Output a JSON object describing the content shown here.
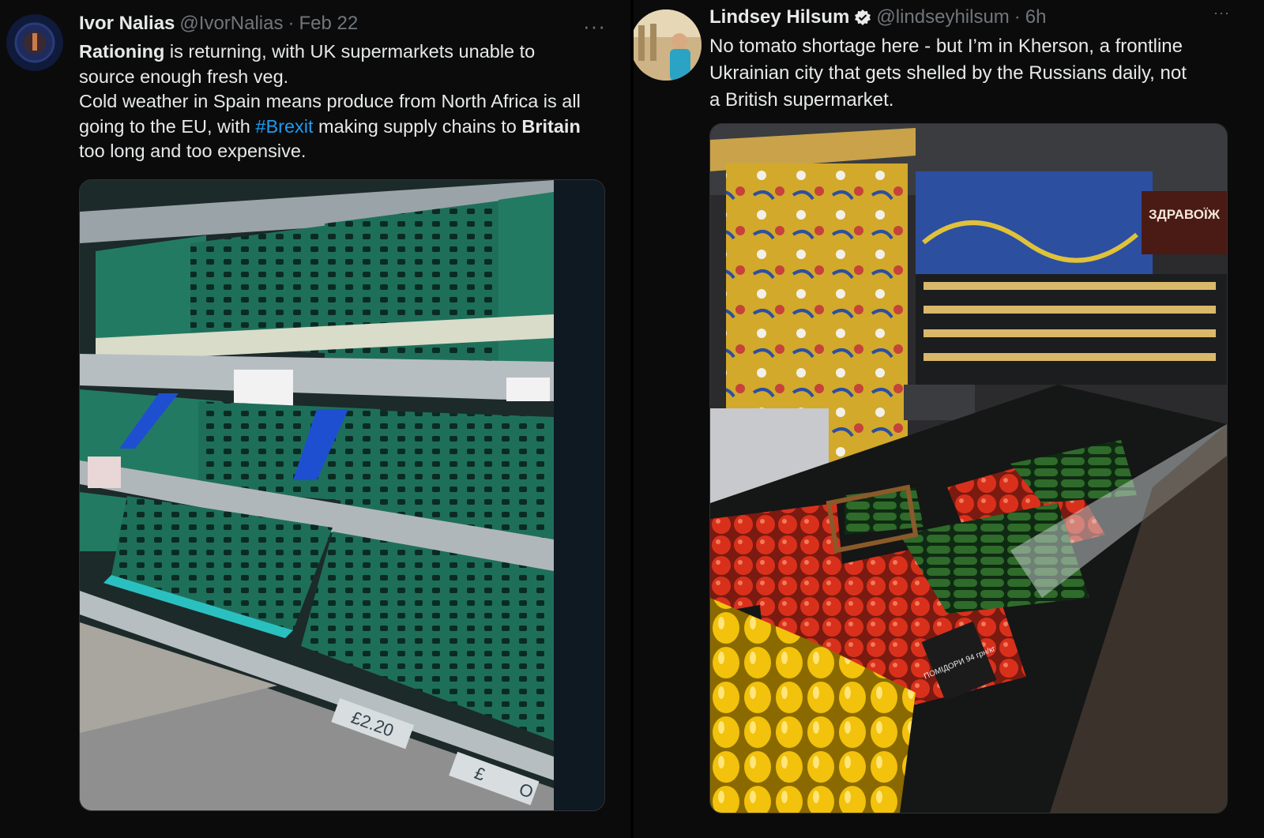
{
  "tweets": [
    {
      "author_name": "Ivor Nalias",
      "handle": "@IvorNalias",
      "separator": "·",
      "time": "Feb 22",
      "more_label": "···",
      "text_lines": {
        "l1_bold": "Rationing",
        "l1_rest": " is returning, with UK supermarkets unable to",
        "l2": "source enough fresh veg.",
        "l3": "Cold weather in Spain means produce from North Africa is all",
        "l4_a": "going to the EU, with ",
        "l4_hashtag": "#Brexit",
        "l4_b": " making supply chains to ",
        "l4_bold": "Britain",
        "l5": "too long and too expensive."
      },
      "media_price_1": "£2.20",
      "media_price_2": "£",
      "media_price_2b": "O"
    },
    {
      "author_name": "Lindsey Hilsum",
      "handle": "@lindseyhilsum",
      "separator": "·",
      "time": "6h",
      "more_label": "···",
      "text_lines": {
        "l1": "No tomato shortage here - but I’m in Kherson, a frontline",
        "l2": "Ukrainian city that gets shelled by the Russians daily, not",
        "l3": "a British supermarket."
      },
      "media_sign": "ЗДРАВОЇЖ",
      "media_tag": "ПОМІДОРИ 94 грн/кг"
    }
  ],
  "colors": {
    "background": "#0b0b0b",
    "text": "#e7e9ea",
    "secondary": "#71767b",
    "link": "#1d9bf0",
    "verified": "#1d9bf0"
  }
}
